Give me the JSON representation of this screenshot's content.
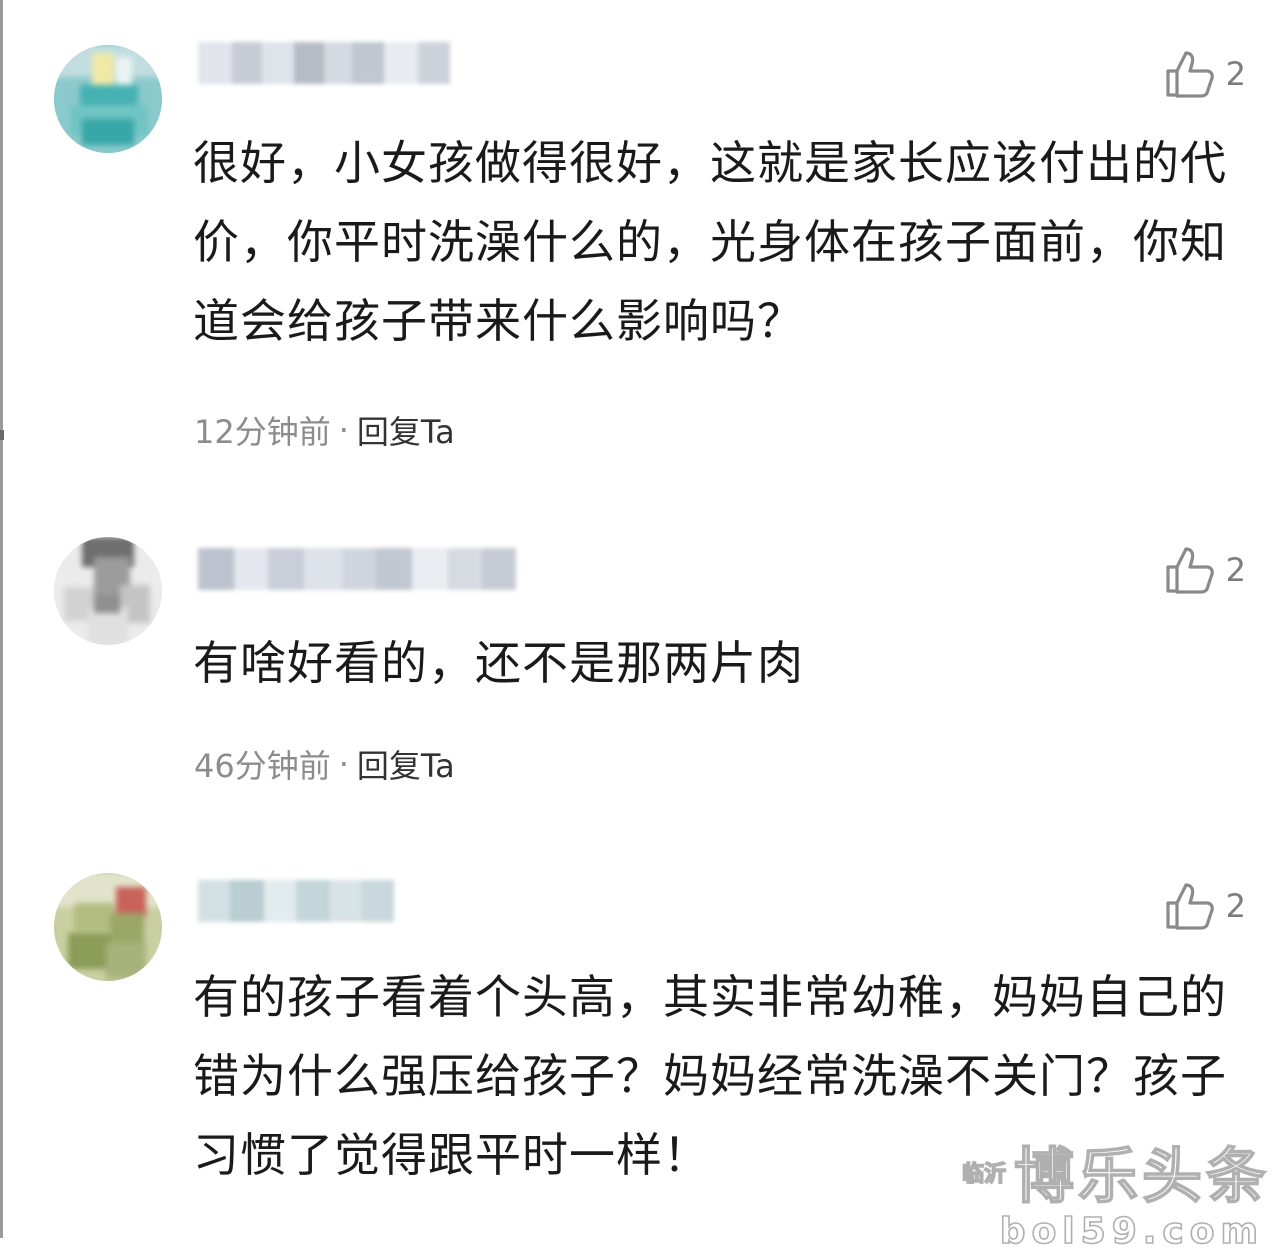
{
  "comments": [
    {
      "text": "很好，小女孩做得很好，这就是家长应该付出的代价，你平时洗澡什么的，光身体在孩子面前，你知道会给孩子带来什么影响吗？",
      "time": "12分钟前",
      "separator": "·",
      "reply": "回复Ta",
      "likes": "2"
    },
    {
      "text": "有啥好看的，还不是那两片肉",
      "time": "46分钟前",
      "separator": "·",
      "reply": "回复Ta",
      "likes": "2"
    },
    {
      "text": "有的孩子看着个头高，其实非常幼稚，妈妈自己的错为什么强压给孩子？妈妈经常洗澡不关门？孩子习惯了觉得跟平时一样！",
      "time": "",
      "separator": "",
      "reply": "",
      "likes": "2"
    }
  ],
  "icons": {
    "like": "thumbs-up-icon",
    "avatar": "pixelated-avatar",
    "username": "pixelated-username"
  },
  "colors": {
    "text": "#1a1a1a",
    "meta": "#8c8c8c",
    "reply": "#333333",
    "icon": "#8a8a8a"
  },
  "watermark": {
    "small": "临沂",
    "big": "博乐头条",
    "url": "bol59.com"
  }
}
